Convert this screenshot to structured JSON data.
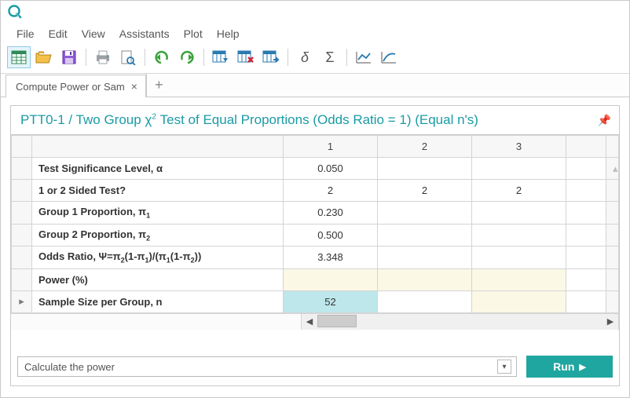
{
  "menubar": [
    "File",
    "Edit",
    "View",
    "Assistants",
    "Plot",
    "Help"
  ],
  "tab": {
    "label": "Compute Power or Sam"
  },
  "section_title_parts": {
    "prefix": "PTT0-1 / Two Group ",
    "chi": "χ",
    "suffix": " Test of Equal Proportions (Odds Ratio = 1) (Equal n's)"
  },
  "col_headers": [
    "1",
    "2",
    "3"
  ],
  "rows": [
    {
      "label": "Test Significance Level, α",
      "values": [
        "0.050",
        "",
        ""
      ],
      "hl": [
        "",
        "",
        ""
      ]
    },
    {
      "label": "1 or 2 Sided Test?",
      "values": [
        "2",
        "2",
        "2"
      ],
      "hl": [
        "",
        "",
        ""
      ]
    },
    {
      "label_html": "Group 1 Proportion, π<sub>1</sub>",
      "values": [
        "0.230",
        "",
        ""
      ],
      "hl": [
        "",
        "",
        ""
      ]
    },
    {
      "label_html": "Group 2 Proportion, π<sub>2</sub>",
      "values": [
        "0.500",
        "",
        ""
      ],
      "hl": [
        "",
        "",
        ""
      ]
    },
    {
      "label_html": "Odds Ratio, Ψ=π<sub>2</sub>(1-π<sub>1</sub>)/(π<sub>1</sub>(1-π<sub>2</sub>))",
      "values": [
        "3.348",
        "",
        ""
      ],
      "hl": [
        "",
        "",
        ""
      ]
    },
    {
      "label": "Power (%)",
      "values": [
        "",
        "",
        ""
      ],
      "hl": [
        "y",
        "y",
        "y"
      ]
    },
    {
      "label": "Sample Size per Group, n",
      "values": [
        "52",
        "",
        ""
      ],
      "hl": [
        "b",
        "",
        "y"
      ],
      "indicator": "▸"
    }
  ],
  "footer": {
    "select_label": "Calculate the power",
    "run_label": "Run"
  },
  "colors": {
    "accent": "#1a9ba5",
    "run": "#1fa6a0",
    "highlight_yellow": "#fbf8e6",
    "highlight_blue": "#bde7ea"
  }
}
